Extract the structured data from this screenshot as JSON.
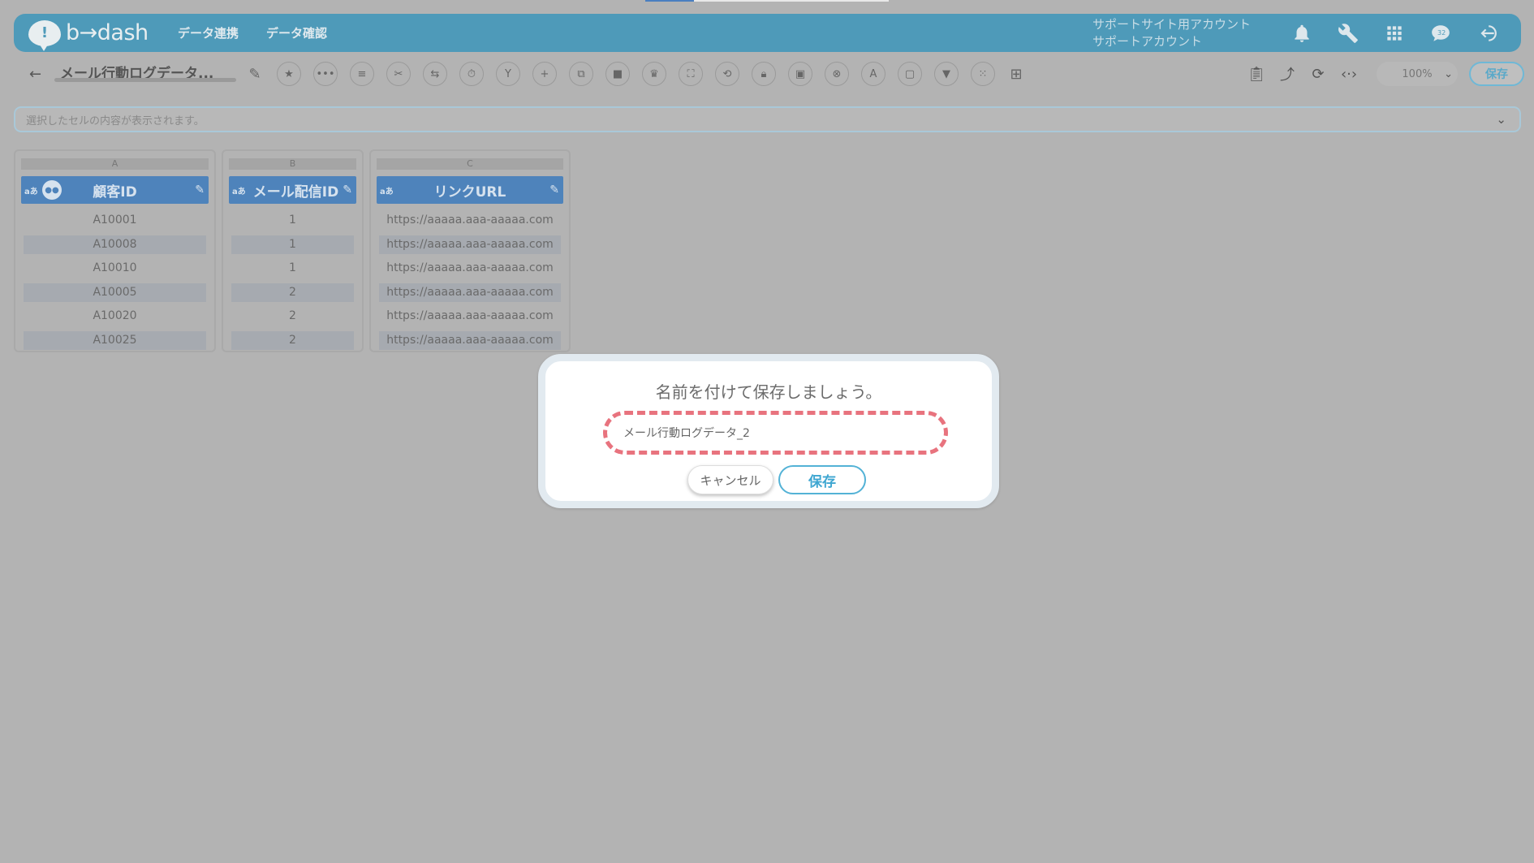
{
  "header": {
    "logo_text": "b→dash",
    "nav": [
      "データ連携",
      "データ確認"
    ],
    "account_line1": "サポートサイト用アカウント",
    "account_line2": "サポートアカウント",
    "badge": "32"
  },
  "toolbar": {
    "doc_title": "メール行動ログデータ...",
    "zoom": "100%",
    "save_label": "保存"
  },
  "formula_bar": {
    "placeholder": "選択したセルの内容が表示されます。"
  },
  "sheet": {
    "type_tag": "aあ",
    "columns": [
      {
        "letter": "A",
        "header": "顧客ID",
        "cells": [
          "A10001",
          "A10008",
          "A10010",
          "A10005",
          "A10020",
          "A10025"
        ]
      },
      {
        "letter": "B",
        "header": "メール配信ID",
        "cells": [
          "1",
          "1",
          "1",
          "2",
          "2",
          "2"
        ]
      },
      {
        "letter": "C",
        "header": "リンクURL",
        "cells": [
          "https://aaaaa.aaa-aaaaa.com",
          "https://aaaaa.aaa-aaaaa.com",
          "https://aaaaa.aaa-aaaaa.com",
          "https://aaaaa.aaa-aaaaa.com",
          "https://aaaaa.aaa-aaaaa.com",
          "https://aaaaa.aaa-aaaaa.com"
        ]
      }
    ]
  },
  "dialog": {
    "title": "名前を付けて保存しましょう。",
    "input_value": "メール行動ログデータ_2",
    "cancel_label": "キャンセル",
    "save_label": "保存"
  },
  "colors": {
    "header_bg": "#4e9ab9",
    "column_header_bg": "#4e83bb",
    "highlight_dash": "#e8737e",
    "save_accent": "#53b2d6"
  }
}
